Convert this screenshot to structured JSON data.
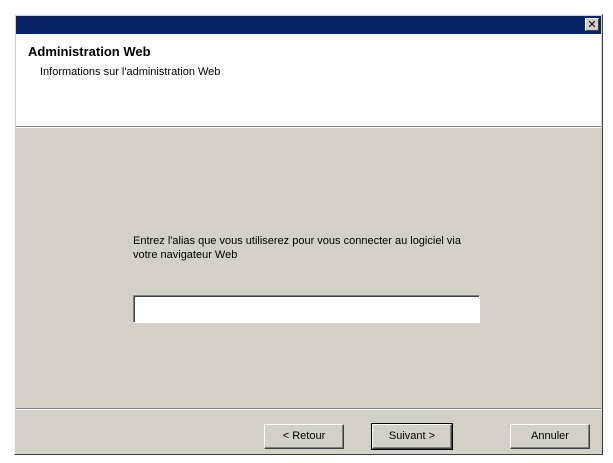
{
  "window": {
    "close_glyph": "✕"
  },
  "header": {
    "title": "Administration Web",
    "subtitle": "Informations sur l'administration Web"
  },
  "main": {
    "instruction": "Entrez l'alias que vous utiliserez pour vous connecter au logiciel via votre navigateur Web",
    "alias_value": ""
  },
  "buttons": {
    "back_label": "< Retour",
    "next_label": "Suivant >",
    "cancel_label": "Annuler"
  },
  "colors": {
    "titlebar": "#0a246a",
    "face": "#d4d0c8",
    "header_bg": "#ffffff"
  }
}
